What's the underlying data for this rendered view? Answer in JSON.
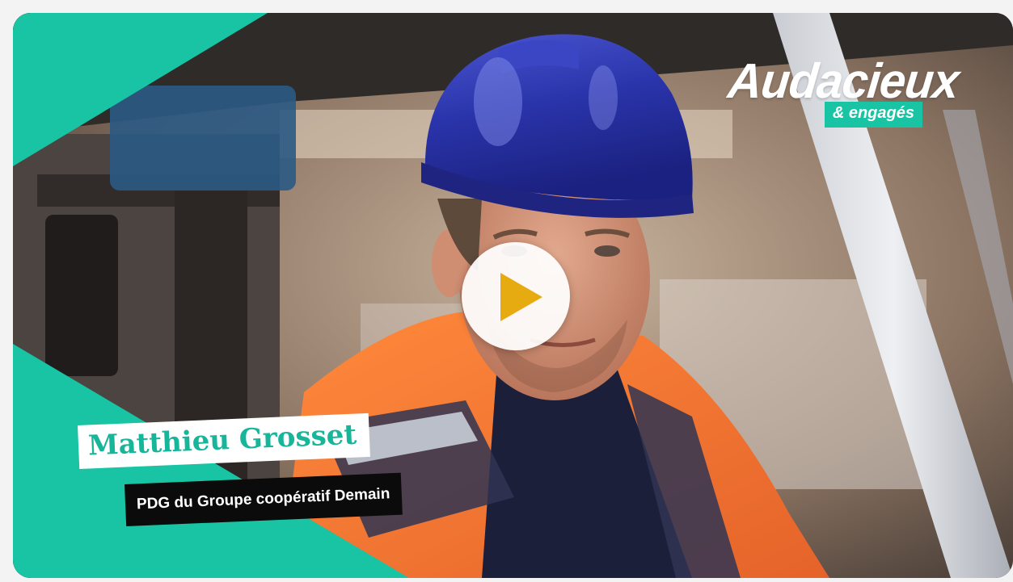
{
  "video": {
    "play_label": "Lire la vidéo",
    "person_name": "Matthieu Grosset",
    "person_role": "PDG du Groupe coopératif Demain"
  },
  "brand": {
    "title": "Audacieux",
    "subtitle": "& engagés"
  },
  "colors": {
    "accent_green": "#18c4a3",
    "play_icon": "#e7ab12",
    "helmet_blue": "#2730a6",
    "jacket_orange": "#f5792f"
  }
}
